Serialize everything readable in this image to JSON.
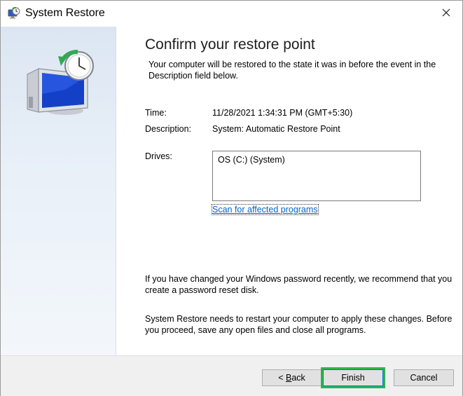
{
  "window": {
    "title": "System Restore",
    "app_icon": "system-restore-icon",
    "close_icon": "close-icon"
  },
  "sidebar": {
    "illustration": "system-restore-monitor-clock-illustration"
  },
  "main": {
    "heading": "Confirm your restore point",
    "intro": "Your computer will be restored to the state it was in before the event in the Description field below.",
    "time_label": "Time:",
    "time_value": "11/28/2021 1:34:31 PM (GMT+5:30)",
    "description_label": "Description:",
    "description_value": "System: Automatic Restore Point",
    "drives_label": "Drives:",
    "drives": [
      "OS (C:) (System)"
    ],
    "scan_link": "Scan for affected programs",
    "password_note": "If you have changed your Windows password recently, we recommend that you create a password reset disk.",
    "restart_note": "System Restore needs to restart your computer to apply these changes. Before you proceed, save any open files and close all programs."
  },
  "footer": {
    "back_label_prefix": "< ",
    "back_label_accel": "B",
    "back_label_rest": "ack",
    "finish_label": "Finish",
    "cancel_label": "Cancel",
    "highlight_color": "#2db34a"
  }
}
